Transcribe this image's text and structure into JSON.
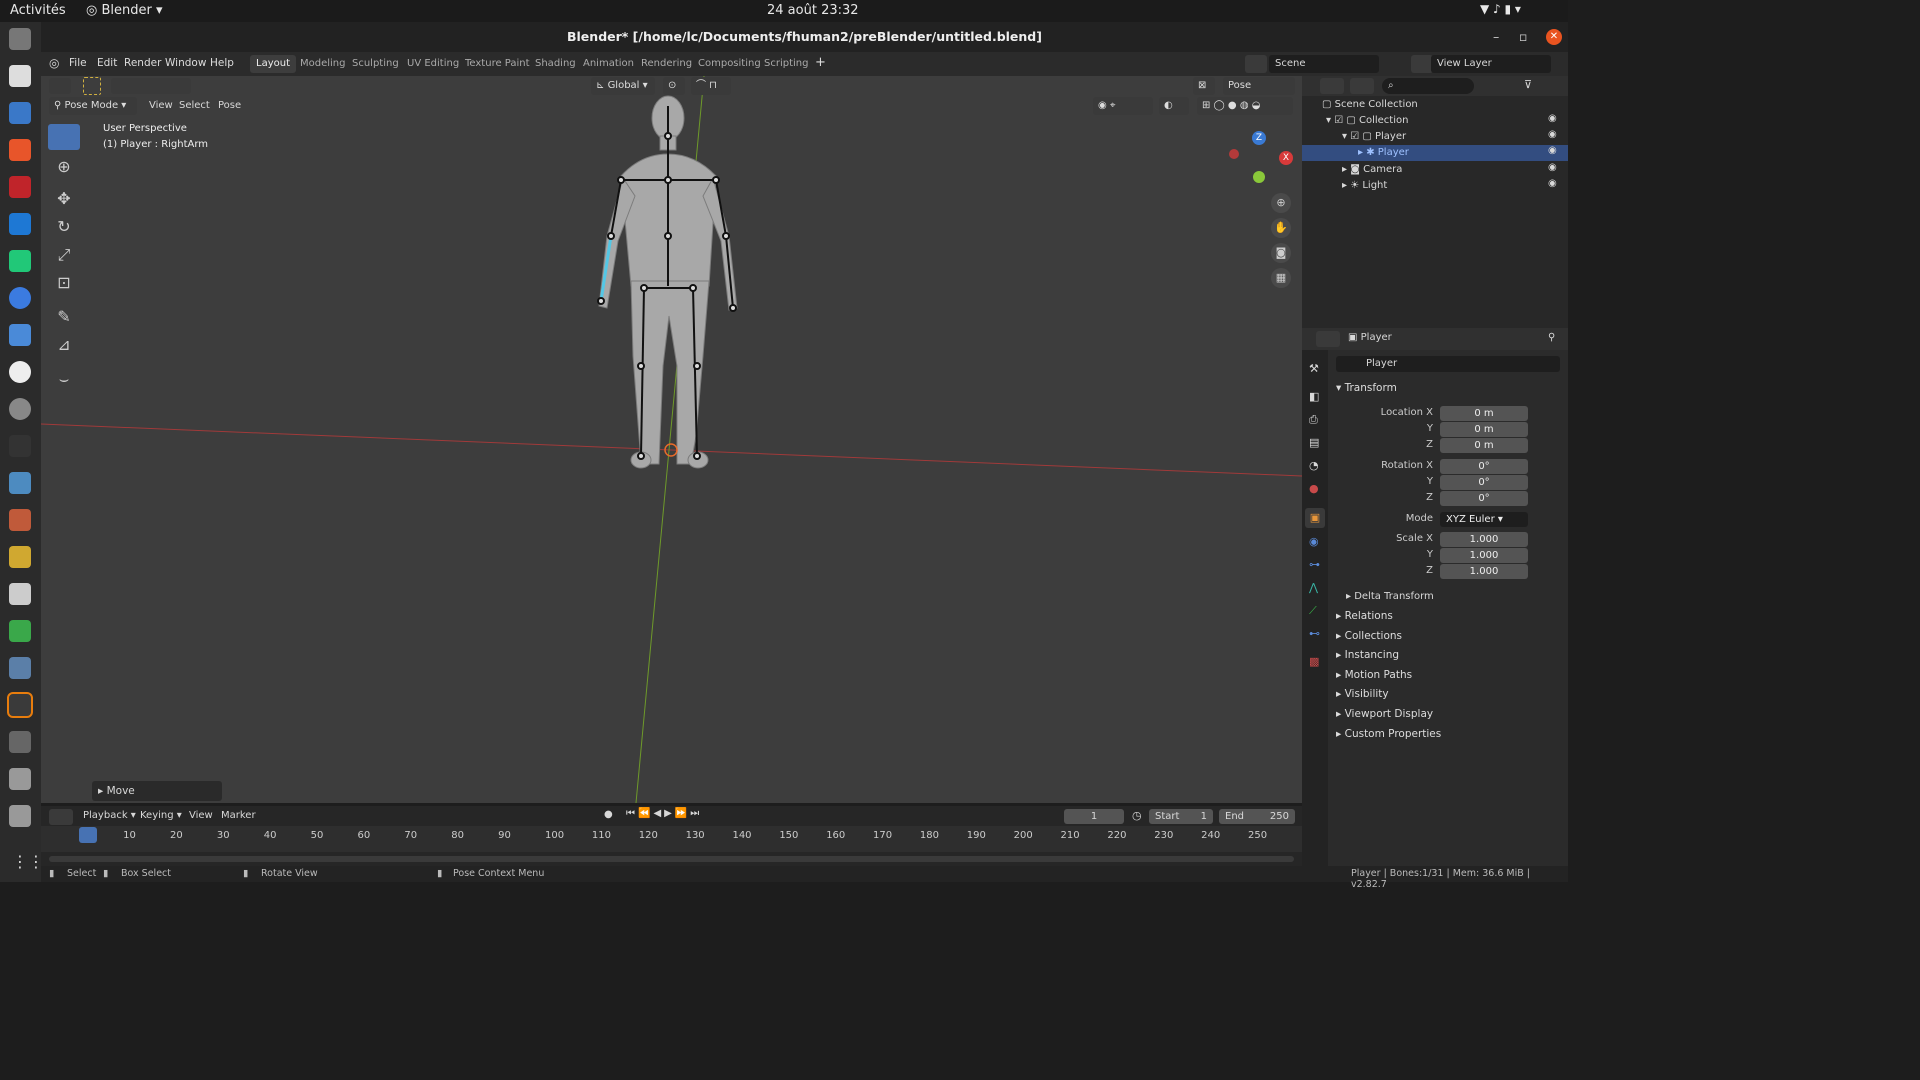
{
  "system": {
    "activities": "Activités",
    "app": "Blender",
    "clock": "24 août  23:32"
  },
  "window": {
    "title": "Blender* [/home/lc/Documents/fhuman2/preBlender/untitled.blend]"
  },
  "menu": [
    "File",
    "Edit",
    "Render",
    "Window",
    "Help"
  ],
  "workspaces": [
    "Layout",
    "Modeling",
    "Sculpting",
    "UV Editing",
    "Texture Paint",
    "Shading",
    "Animation",
    "Rendering",
    "Compositing",
    "Scripting"
  ],
  "scene": {
    "scene_name": "Scene",
    "view_layer": "View Layer"
  },
  "viewport": {
    "transform": "Global",
    "pose_options": "Pose Options",
    "mode": "Pose Mode",
    "header_menus": [
      "View",
      "Select",
      "Pose"
    ],
    "perspective": "User Perspective",
    "active": "(1) Player : RightArm",
    "last_op": "Move",
    "gizmo_x": "X",
    "gizmo_z": "Z"
  },
  "outliner": {
    "root": "Scene Collection",
    "items": [
      "Collection",
      "Player",
      "Player",
      "Camera",
      "Light"
    ]
  },
  "properties": {
    "object": "Player",
    "object_field": "Player",
    "transform_header": "Transform",
    "loc_label": "Location X",
    "rot_label": "Rotation X",
    "scale_label": "Scale X",
    "y": "Y",
    "z": "Z",
    "location": [
      "0 m",
      "0 m",
      "0 m"
    ],
    "rotation": [
      "0°",
      "0°",
      "0°"
    ],
    "mode_label": "Mode",
    "mode": "XYZ Euler",
    "scale": [
      "1.000",
      "1.000",
      "1.000"
    ],
    "delta": "Delta Transform",
    "panels": [
      "Relations",
      "Collections",
      "Instancing",
      "Motion Paths",
      "Visibility",
      "Viewport Display",
      "Custom Properties"
    ]
  },
  "timeline": {
    "menus": [
      "Playback",
      "Keying",
      "View",
      "Marker"
    ],
    "current": "1",
    "start_label": "Start",
    "start": "1",
    "end_label": "End",
    "end": "250",
    "ticks": [
      "1",
      "10",
      "20",
      "30",
      "40",
      "50",
      "60",
      "70",
      "80",
      "90",
      "100",
      "110",
      "120",
      "130",
      "140",
      "150",
      "160",
      "170",
      "180",
      "190",
      "200",
      "210",
      "220",
      "230",
      "240",
      "250"
    ]
  },
  "status": {
    "select": "Select",
    "box": "Box Select",
    "rotate": "Rotate View",
    "context": "Pose Context Menu",
    "info": "Player | Bones:1/31 | Mem: 36.6 MiB | v2.82.7"
  },
  "colors": {
    "accent": "#4772b3",
    "xaxis": "#b33a3a",
    "yaxis": "#6a9a2a",
    "selected_bone": "#54c7e5"
  }
}
